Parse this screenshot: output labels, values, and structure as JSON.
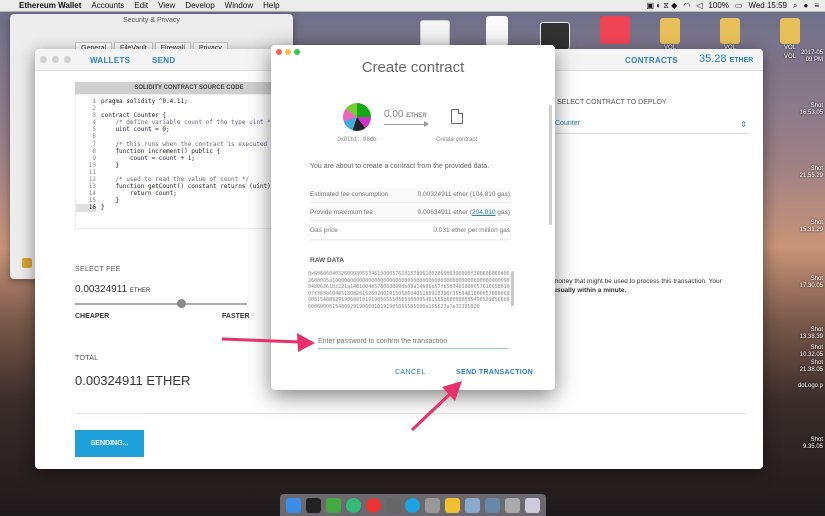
{
  "menubar": {
    "app": "Ethereum Wallet",
    "items": [
      "Accounts",
      "Edit",
      "View",
      "Develop",
      "Window",
      "Help"
    ],
    "battery": "100%",
    "clock": "Wed 15:59"
  },
  "security_window": {
    "title": "Security & Privacy",
    "tabs": [
      "General",
      "FileVault",
      "Firewall",
      "Privacy"
    ]
  },
  "desktop": {
    "side_labels": [
      "2017-05\n09 PM",
      "Shot\n16.53.05",
      "Shot\n21.55.29",
      "Shot\n15.31.29",
      "Shot\n17.30.05",
      "Shot\n13.38.39",
      "Shot\n10.32.05",
      "Shot\n21.38.05",
      "doLogo.p",
      "Shot\n9.35.05"
    ],
    "vol_labels": [
      "VOL",
      "VOL",
      "VOL",
      "VOL"
    ]
  },
  "wallet": {
    "nav_wallets": "WALLETS",
    "nav_send": "SEND",
    "nav_contracts": "CONTRACTS",
    "balance": "35.28",
    "balance_unit": "ETHER",
    "code_header": "SOLIDITY CONTRACT SOURCE CODE",
    "deploy_label": "SELECT CONTRACT TO DEPLOY",
    "deploy_selected": "Counter",
    "select_fee_label": "SELECT FEE",
    "fee_value": "0.00324911",
    "fee_unit": "ETHER",
    "fee_position": 0.62,
    "cheaper": "CHEAPER",
    "faster": "FASTER",
    "total_label": "TOTAL",
    "total_value": "0.00324911 ETHER",
    "note_text": "money that might be used to process this transaction. Your",
    "note_bold": "usually within a minute.",
    "sending_button": "SENDING..."
  },
  "modal": {
    "title": "Create contract",
    "from_address": "0x01b1…98db",
    "amount": "0.00",
    "amount_unit": "ETHER",
    "target_label": "Create contract",
    "about": "You are about to create a contract from the provided data.",
    "estimated_fee_label": "Estimated fee consumption",
    "estimated_fee_value": "0.00324911 ether (104,810 gas)",
    "max_fee_label": "Provide maximum fee",
    "max_fee_value_prefix": "0.00634911 ether (",
    "max_fee_link": "204,810",
    "max_fee_value_suffix": " gas)",
    "gas_price_label": "Gas price",
    "gas_price_value": "0.031 ether per million gas",
    "raw_label": "RAW DATA",
    "raw_data": "0x6060604052600080553461000057610157806100206000396000f3006060604052600035a1000000000000000000000000000000000000000000000000000000009004806361bc221a1461004e578063d09de08a14606b57fb5b346100005761005861007f565b6040518082815260200191505060405180910390f35b3461000057600060008154809291906001019190505550565b60005481565b6000600054905090565b6000600081548092919060010191905055505600a165627a7a72305820",
    "password_placeholder": "Enter password to confirm the transaction",
    "cancel": "CANCEL",
    "send": "SEND TRANSACTION"
  },
  "source_code": {
    "line_numbers": [
      "1",
      "2",
      "3",
      "4",
      "5",
      "6",
      "7",
      "8",
      "9",
      "10",
      "11",
      "12",
      "13",
      "14",
      "15",
      "16"
    ],
    "lines": [
      "pragma solidity ^0.4.11;",
      "",
      "contract Counter {",
      "    /* define variable count of the type uint */",
      "    uint count = 0;",
      "",
      "    /* this runs when the contract is executed */",
      "    function increment() public {",
      "        count = count + 1;",
      "    }",
      "",
      "    /* used to read the value of count */",
      "    function getCount() constant returns (uint) {",
      "        return count;",
      "    }",
      "}"
    ]
  },
  "colors": {
    "accent": "#2a7fc7",
    "button": "#1ea0d8",
    "annotation": "#e8306a"
  }
}
